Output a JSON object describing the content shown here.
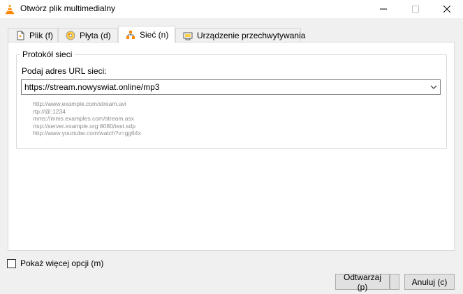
{
  "window": {
    "title": "Otwórz plik multimedialny"
  },
  "tabs": [
    {
      "label": "Plik (f)",
      "icon": "file-icon"
    },
    {
      "label": "Płyta (d)",
      "icon": "disc-icon"
    },
    {
      "label": "Sieć (n)",
      "icon": "network-icon",
      "active": true
    },
    {
      "label": "Urządzenie przechwytywania",
      "icon": "capture-device-icon"
    }
  ],
  "network": {
    "group_title": "Protokół sieci",
    "url_label": "Podaj adres URL sieci:",
    "url_value": "https://stream.nowyswiat.online/mp3",
    "examples": [
      "http://www.example.com/stream.avi",
      "rtp://@:1234",
      "mms://mms.examples.com/stream.asx",
      "rtsp://server.example.org:8080/test.sdp",
      "http://www.yourtube.com/watch?v=gg64x"
    ]
  },
  "options": {
    "more_options_label": "Pokaż więcej opcji (m)",
    "checked": false
  },
  "buttons": {
    "play_label": "Odtwarzaj (p)",
    "cancel_label": "Anuluj (c)"
  },
  "colors": {
    "accent": "#ff8800",
    "panel_bg": "#ffffff",
    "dialog_bg": "#f0f0f0"
  }
}
